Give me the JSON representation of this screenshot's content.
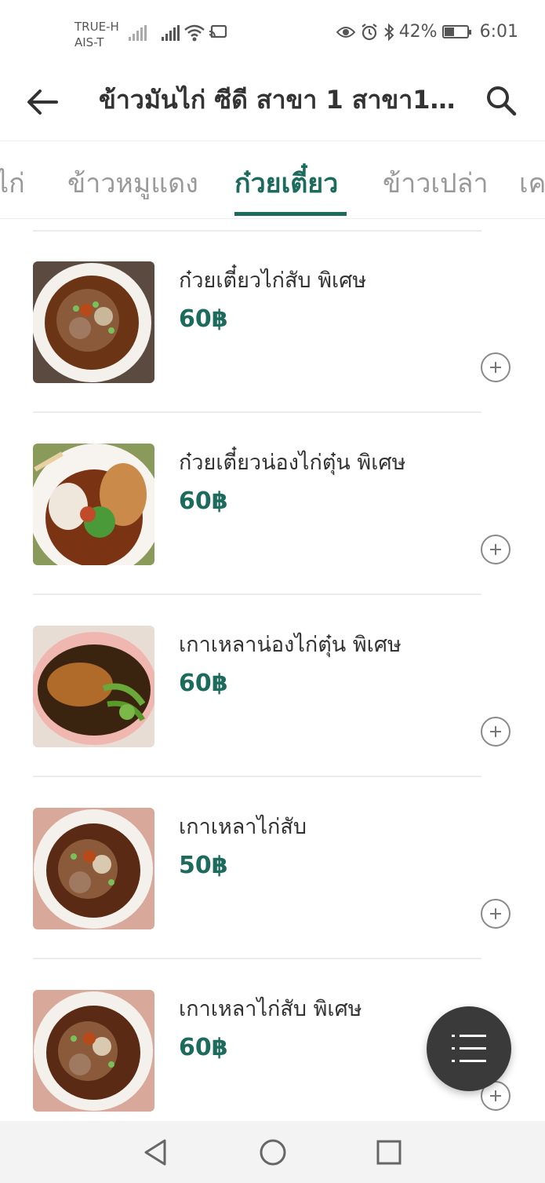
{
  "status_bar": {
    "carrier_1": "TRUE-H",
    "carrier_2": "AIS-T",
    "battery_percent": "42%",
    "battery_level": 0.42,
    "time": "6:01"
  },
  "header": {
    "title": "ข้าวมันไก่ ซีดี สาขา 1 สาขา1 (..."
  },
  "tabs": [
    {
      "label": "ไก่"
    },
    {
      "label": "ข้าวหมูแดง"
    },
    {
      "label": "ก๋วยเตี๋ยว",
      "active": true
    },
    {
      "label": "ข้าวเปล่า"
    },
    {
      "label": "เค"
    }
  ],
  "menu_items": [
    {
      "name": "ก๋วยเตี๋ยวไก่สับ พิเศษ",
      "price": "60฿"
    },
    {
      "name": "ก๋วยเตี๋ยวน่องไก่ตุ๋น พิเศษ",
      "price": "60฿"
    },
    {
      "name": "เกาเหลาน่องไก่ตุ๋น พิเศษ",
      "price": "60฿"
    },
    {
      "name": "เกาเหลาไก่สับ",
      "price": "50฿"
    },
    {
      "name": "เกาเหลาไก่สับ พิเศษ",
      "price": "60฿"
    }
  ],
  "colors": {
    "accent": "#1d6b5d",
    "fab": "#3a3a3a"
  }
}
